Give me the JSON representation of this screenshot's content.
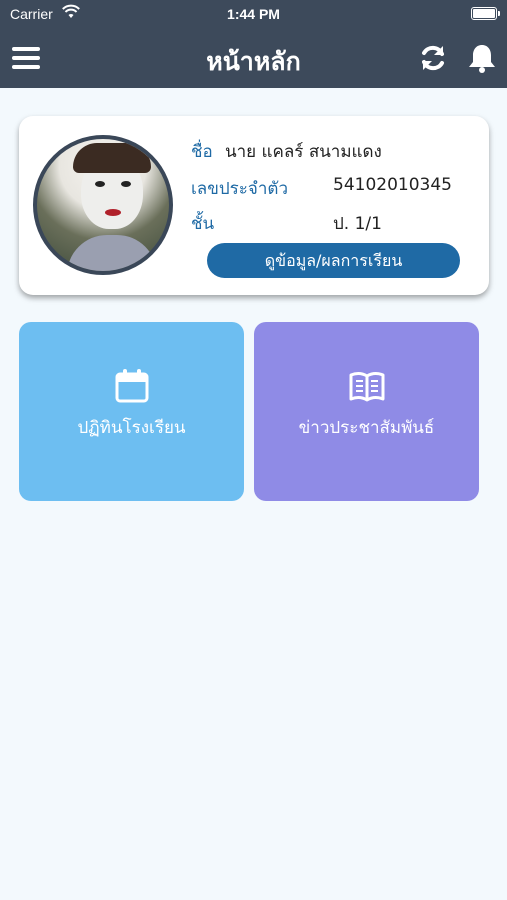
{
  "status_bar": {
    "carrier": "Carrier",
    "time": "1:44 PM"
  },
  "navbar": {
    "title": "หน้าหลัก",
    "menu_icon": "hamburger-icon",
    "refresh_icon": "refresh-icon",
    "notification_icon": "bell-icon"
  },
  "profile": {
    "name_label": "ชื่อ",
    "name_value": "นาย แคลร์ สนามแดง",
    "id_label": "เลขประจำตัว",
    "id_value": "54102010345",
    "class_label": "ชั้น",
    "class_value": "ป. 1/1",
    "detail_button": "ดูข้อมูล/ผลการเรียน"
  },
  "tiles": [
    {
      "label": "ปฏิทินโรงเรียน",
      "icon": "calendar-icon",
      "color": "#6dbef1"
    },
    {
      "label": "ข่าวประชาสัมพันธ์",
      "icon": "book-icon",
      "color": "#8f8be6"
    }
  ],
  "colors": {
    "header": "#3d4a5b",
    "accent": "#1f6aa5",
    "background": "#f3f9fd"
  }
}
